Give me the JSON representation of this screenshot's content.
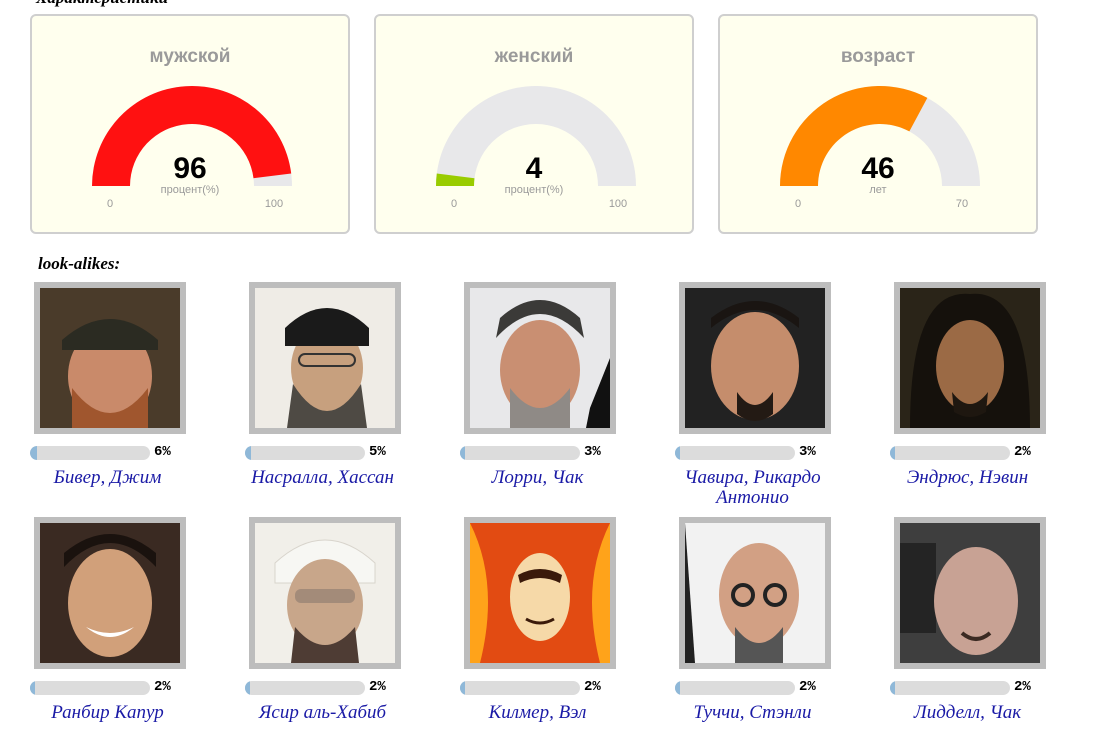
{
  "header": {
    "clipped_text": "Характеристики"
  },
  "gauges": [
    {
      "title": "мужской",
      "value": "96",
      "unit": "процент(%)",
      "min": "0",
      "max": "100",
      "fraction": 0.96,
      "color": "#ff1111"
    },
    {
      "title": "женский",
      "value": "4",
      "unit": "процент(%)",
      "min": "0",
      "max": "100",
      "fraction": 0.04,
      "color": "#99cc00"
    },
    {
      "title": "возраст",
      "value": "46",
      "unit": "лет",
      "min": "0",
      "max": "70",
      "fraction": 0.657,
      "color": "#ff8800"
    }
  ],
  "lookalikes": {
    "label": "look-alikes:",
    "items": [
      {
        "name": "Бивер, Джим",
        "percent": "6%",
        "fraction": 0.06
      },
      {
        "name": "Насралла, Хассан",
        "percent": "5%",
        "fraction": 0.05
      },
      {
        "name": "Лорри, Чак",
        "percent": "3%",
        "fraction": 0.03
      },
      {
        "name": "Чавира, Рикардо Антонио",
        "percent": "3%",
        "fraction": 0.03
      },
      {
        "name": "Эндрюс, Нэвин",
        "percent": "2%",
        "fraction": 0.02
      },
      {
        "name": "Ранбир Капур",
        "percent": "2%",
        "fraction": 0.02
      },
      {
        "name": "Ясир аль-Хабиб",
        "percent": "2%",
        "fraction": 0.02
      },
      {
        "name": "Килмер, Вэл",
        "percent": "2%",
        "fraction": 0.02
      },
      {
        "name": "Туччи, Стэнли",
        "percent": "2%",
        "fraction": 0.02
      },
      {
        "name": "Лидделл, Чак",
        "percent": "2%",
        "fraction": 0.02
      }
    ]
  }
}
